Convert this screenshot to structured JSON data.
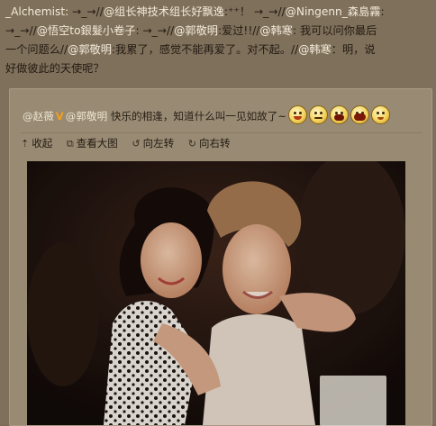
{
  "repost": {
    "line1": {
      "u0": "_Alchemist:",
      "t0": " →_→//",
      "u1": "@组长神技术组长好飘逸",
      "t1": ":⁺⁺！ →_→//",
      "u2": "@Ningenn_森島霧",
      "t2": ":"
    },
    "line2": {
      "t0": "→_→//",
      "u0": "@悟空to銀髮小卷子",
      "t1": ": →_→//",
      "u1": "@郭敬明",
      "t2": ":爱过!!//",
      "u2": "@韩寒",
      "t3": ": 我可以问你最后"
    },
    "line3": {
      "t0": "一个问题么//",
      "u0": "@郭敬明",
      "t1": ":我累了，感觉不能再爱了。对不起。//",
      "u1": "@韩寒",
      "t2": "：明，说"
    },
    "line4": {
      "t0": "好做彼此的天使呢？"
    }
  },
  "original": {
    "author": "@赵薇",
    "v_badge": "V",
    "mention": "@郭敬明",
    "text": " 快乐的相逢，知道什么叫一见如故了~"
  },
  "toolbar": {
    "collapse": "收起",
    "view_large": "查看大图",
    "rotate_left": "向左转",
    "rotate_right": "向右转"
  },
  "icons": [
    "collapse-icon",
    "view-large-icon",
    "rotate-left-icon",
    "rotate-right-icon"
  ],
  "colors": {
    "background": "#7f705b",
    "card": "#988a73",
    "mention": "#f3ead9",
    "text": "#231a12"
  }
}
